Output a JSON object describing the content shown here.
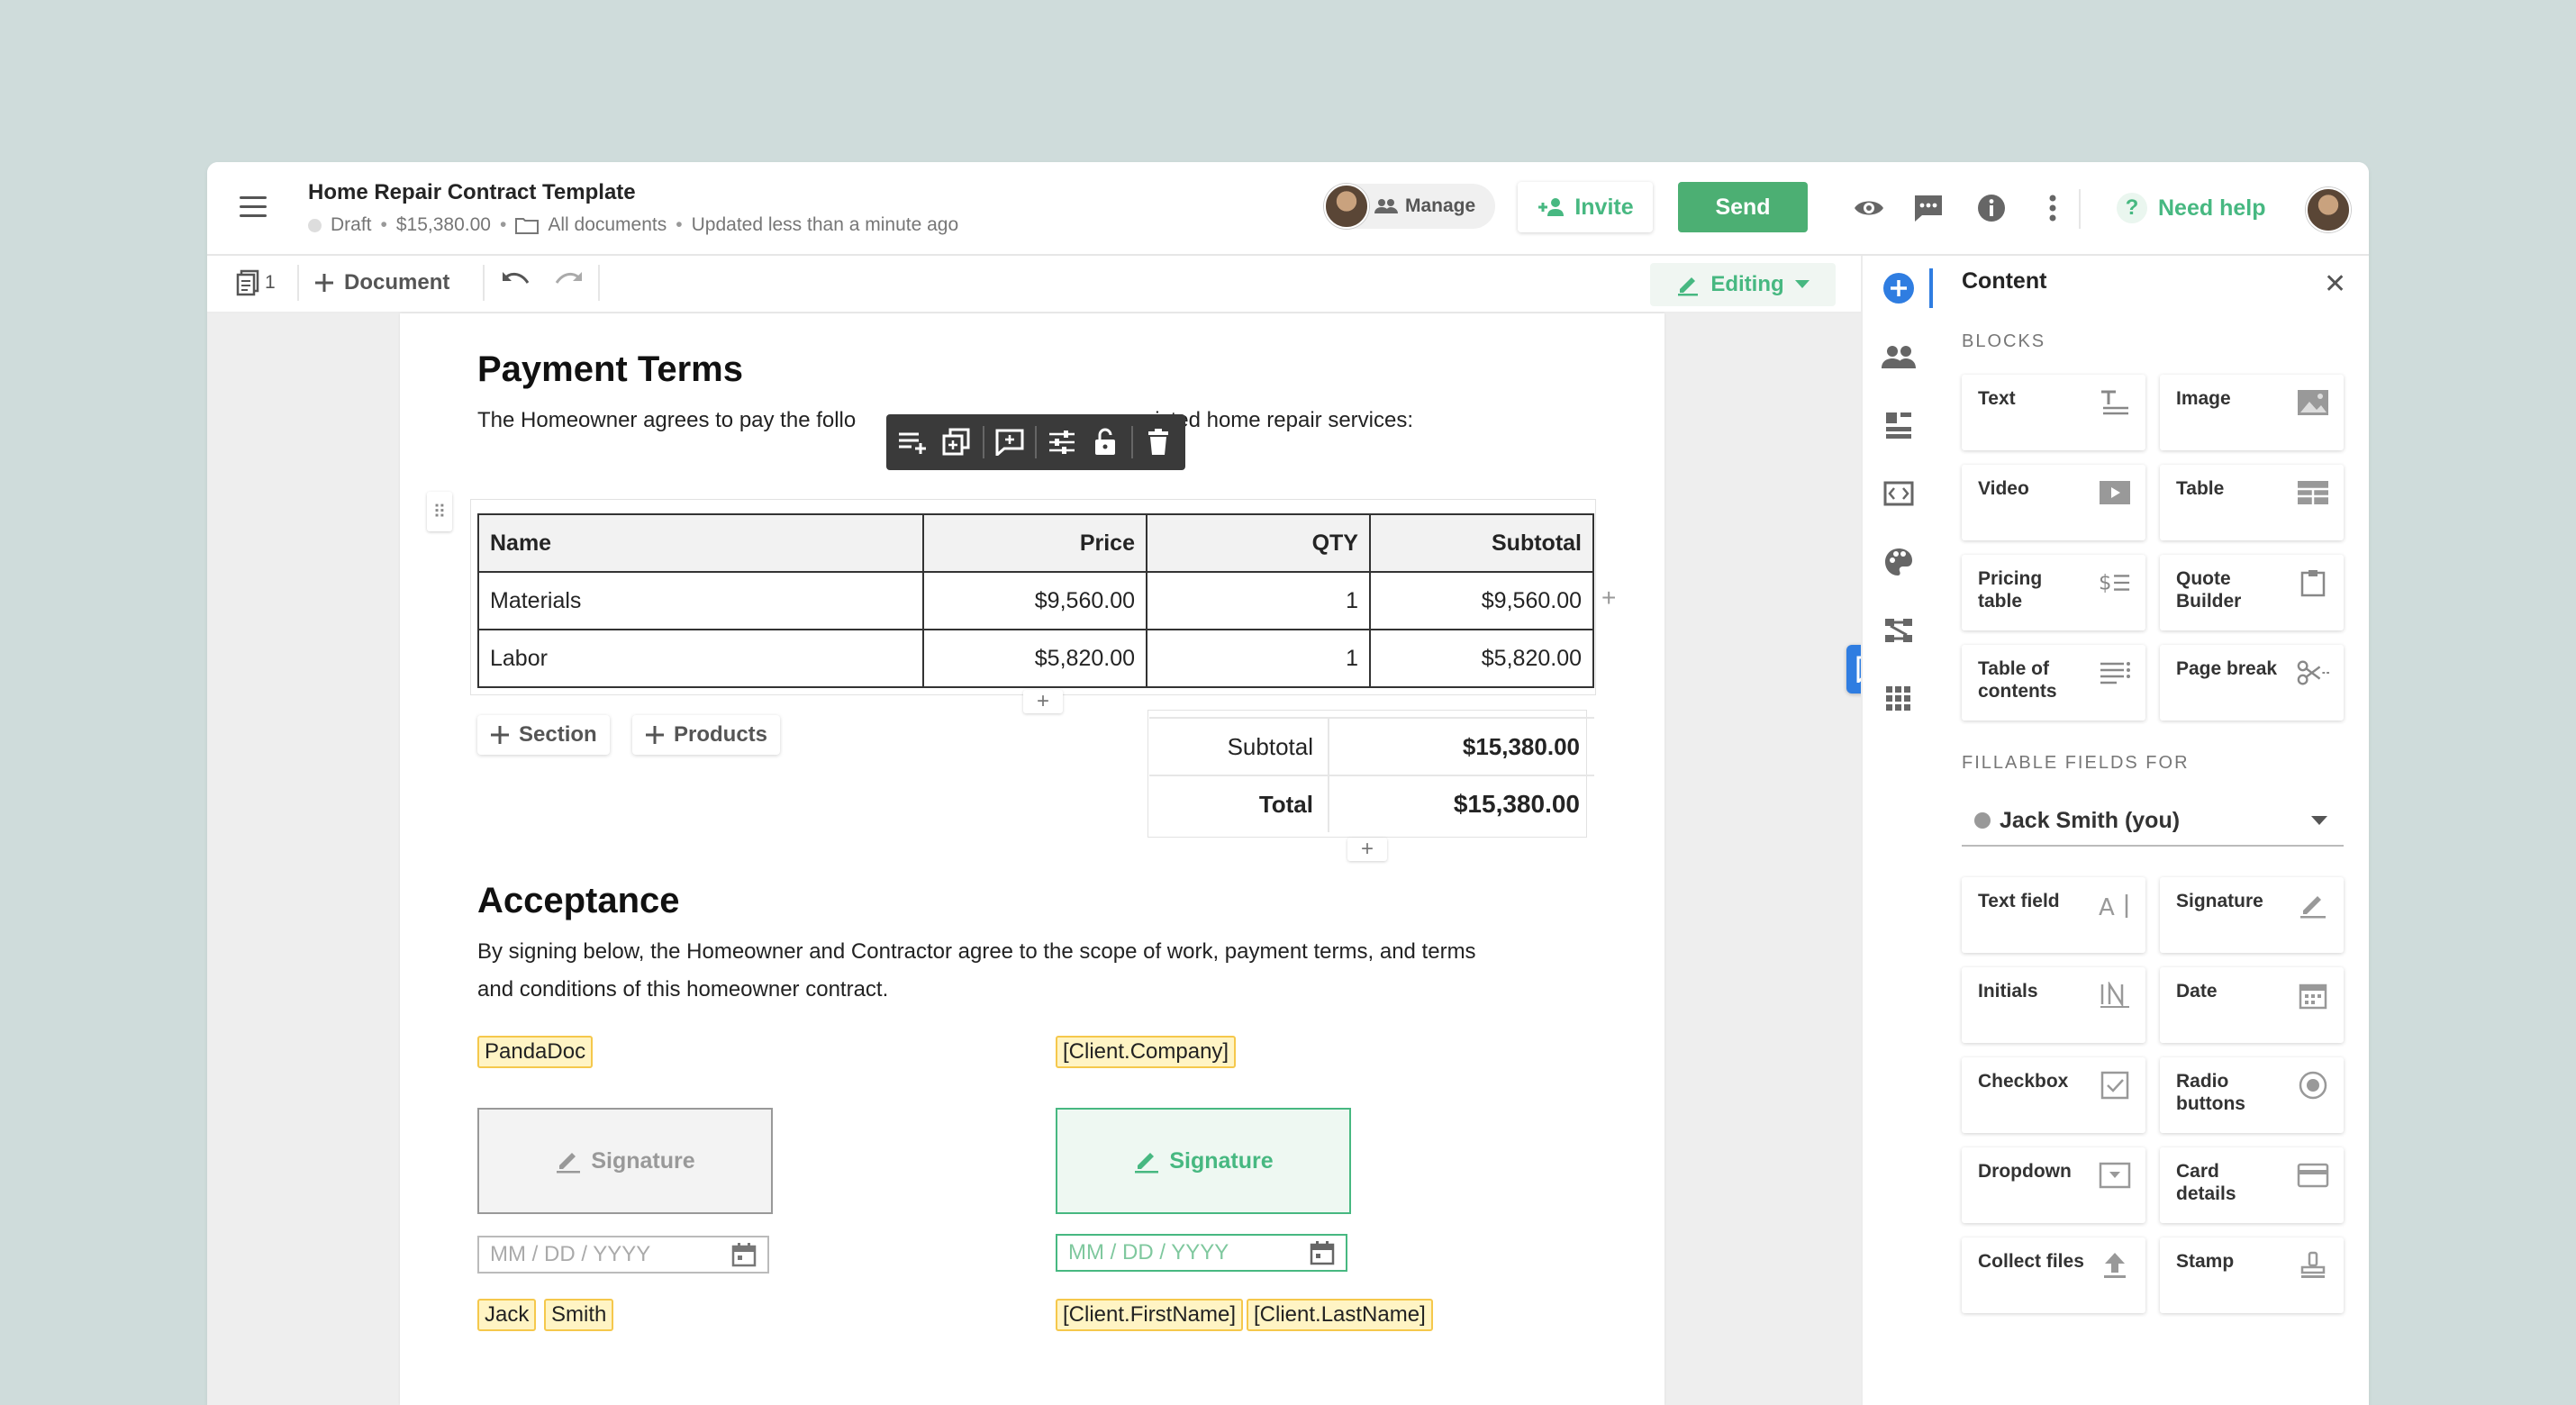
{
  "header": {
    "title": "Home Repair Contract Template",
    "status": "Draft",
    "amount": "$15,380.00",
    "folder": "All documents",
    "updated": "Updated less than a minute ago",
    "manage_label": "Manage",
    "invite_label": "Invite",
    "send_label": "Send",
    "help_label": "Need help"
  },
  "toolbar": {
    "page_count": "1",
    "add_document_label": "Document",
    "mode_label": "Editing"
  },
  "document": {
    "payment_heading": "Payment Terms",
    "payment_text_left": "The Homeowner agrees to pay the follo",
    "payment_text_right": "isted home repair services:",
    "table": {
      "headers": [
        "Name",
        "Price",
        "QTY",
        "Subtotal"
      ],
      "rows": [
        [
          "Materials",
          "$9,560.00",
          "1",
          "$9,560.00"
        ],
        [
          "Labor",
          "$5,820.00",
          "1",
          "$5,820.00"
        ]
      ]
    },
    "add_section_label": "Section",
    "add_products_label": "Products",
    "summary": {
      "subtotal_label": "Subtotal",
      "subtotal_value": "$15,380.00",
      "total_label": "Total",
      "total_value": "$15,380.00"
    },
    "acceptance_heading": "Acceptance",
    "acceptance_line1": "By signing below, the Homeowner and Contractor agree to the scope of work, payment terms, and terms",
    "acceptance_line2": "and conditions of this homeowner contract.",
    "sender": {
      "company": "PandaDoc",
      "signature_label": "Signature",
      "date_placeholder": "MM / DD / YYYY",
      "first_name": "Jack",
      "last_name": "Smith"
    },
    "client": {
      "company": "[Client.Company]",
      "signature_label": "Signature",
      "date_placeholder": "MM / DD / YYYY",
      "first_name": "[Client.FirstName]",
      "last_name": "[Client.LastName]"
    }
  },
  "panel": {
    "title": "Content",
    "blocks_heading": "BLOCKS",
    "blocks": [
      {
        "label": "Text",
        "icon": "text-block-icon"
      },
      {
        "label": "Image",
        "icon": "image-block-icon"
      },
      {
        "label": "Video",
        "icon": "video-block-icon"
      },
      {
        "label": "Table",
        "icon": "table-block-icon"
      },
      {
        "label": "Pricing table",
        "icon": "pricing-table-icon"
      },
      {
        "label": "Quote Builder",
        "icon": "quote-builder-icon"
      },
      {
        "label": "Table of contents",
        "icon": "toc-icon"
      },
      {
        "label": "Page break",
        "icon": "page-break-icon"
      }
    ],
    "fields_heading": "FILLABLE FIELDS FOR",
    "recipient": "Jack Smith (you)",
    "fields": [
      {
        "label": "Text field",
        "icon": "text-field-icon"
      },
      {
        "label": "Signature",
        "icon": "signature-field-icon"
      },
      {
        "label": "Initials",
        "icon": "initials-icon"
      },
      {
        "label": "Date",
        "icon": "date-icon"
      },
      {
        "label": "Checkbox",
        "icon": "checkbox-icon"
      },
      {
        "label": "Radio buttons",
        "icon": "radio-icon"
      },
      {
        "label": "Dropdown",
        "icon": "dropdown-icon"
      },
      {
        "label": "Card details",
        "icon": "card-icon"
      },
      {
        "label": "Collect files",
        "icon": "upload-icon"
      },
      {
        "label": "Stamp",
        "icon": "stamp-icon"
      }
    ]
  },
  "colors": {
    "brand_green": "#47b881",
    "send_green": "#4caf73",
    "accent_blue": "#2f7de1",
    "tag_yellow": "#fff4c4"
  }
}
